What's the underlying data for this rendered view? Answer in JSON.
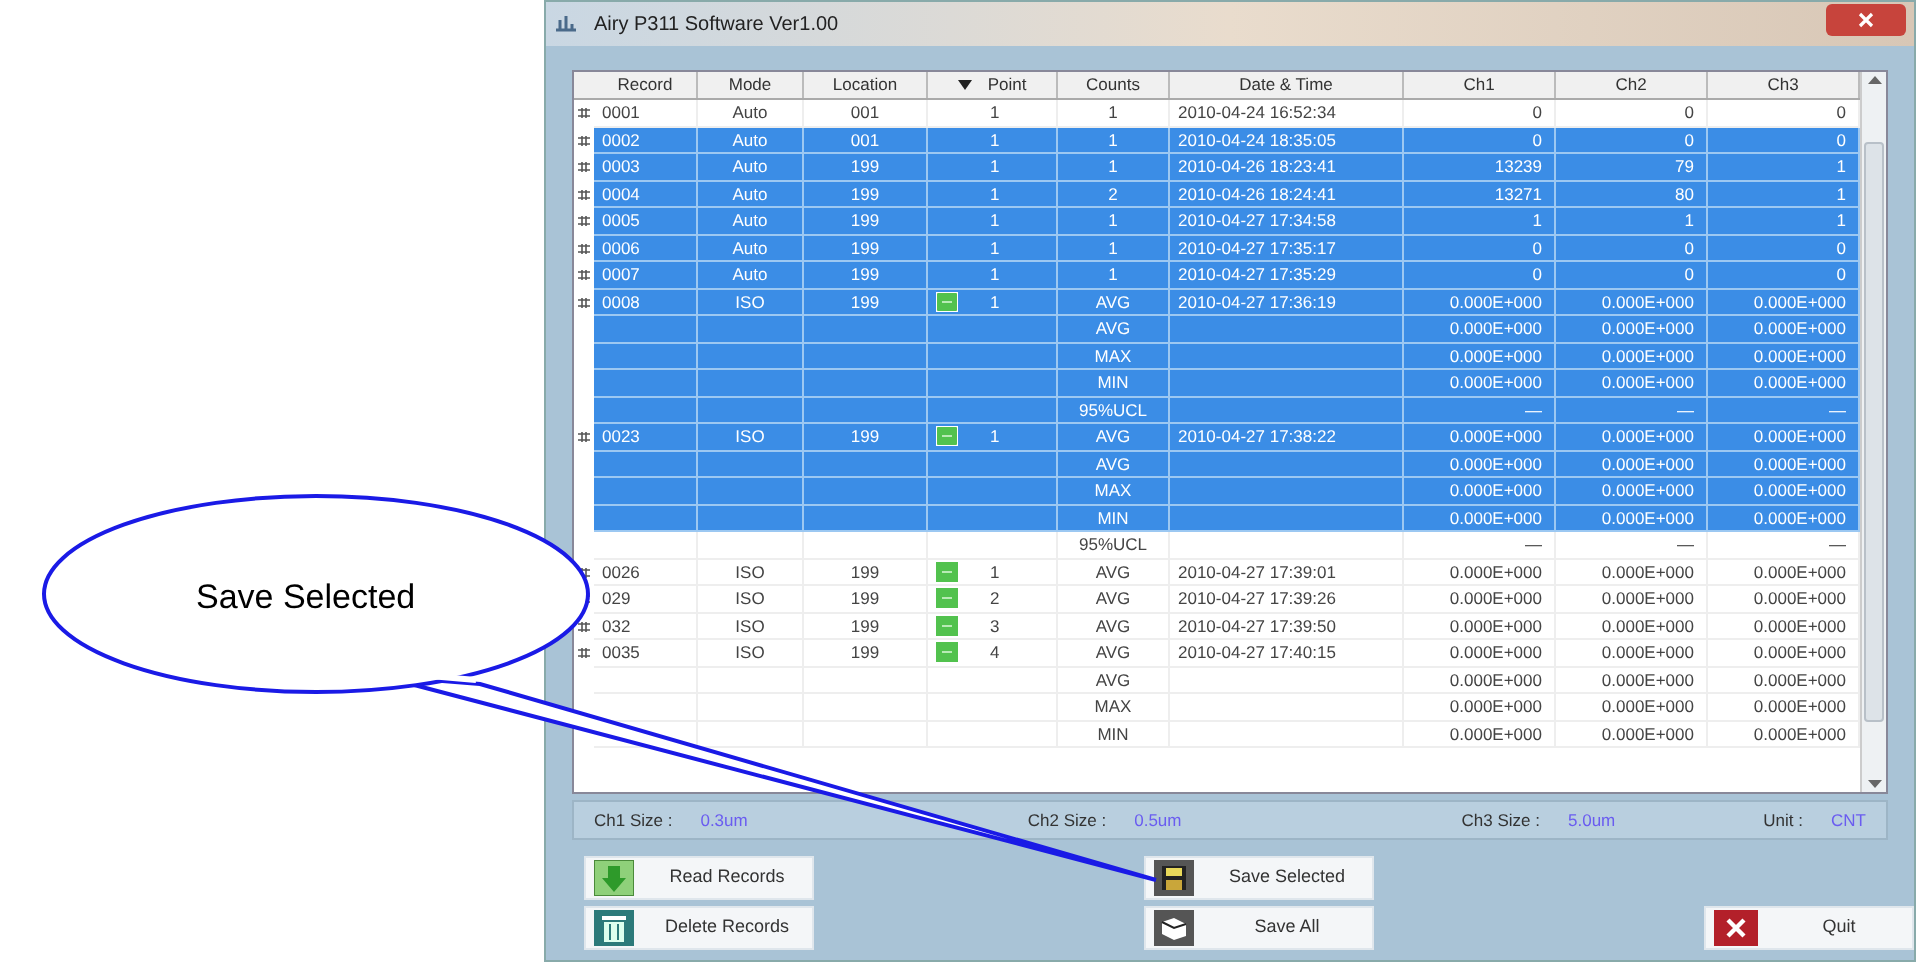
{
  "window": {
    "title": "Airy P311 Software Ver1.00"
  },
  "table": {
    "columns": [
      "Record",
      "Mode",
      "Location",
      "Point",
      "Counts",
      "Date & Time",
      "Ch1",
      "Ch2",
      "Ch3"
    ],
    "rows": [
      {
        "selected": false,
        "record": "0001",
        "mode": "Auto",
        "location": "001",
        "point": "1",
        "counts": "1",
        "date_time": "2010-04-24 16:52:34",
        "ch1": "0",
        "ch2": "0",
        "ch3": "0"
      },
      {
        "selected": true,
        "record": "0002",
        "mode": "Auto",
        "location": "001",
        "point": "1",
        "counts": "1",
        "date_time": "2010-04-24 18:35:05",
        "ch1": "0",
        "ch2": "0",
        "ch3": "0"
      },
      {
        "selected": true,
        "record": "0003",
        "mode": "Auto",
        "location": "199",
        "point": "1",
        "counts": "1",
        "date_time": "2010-04-26 18:23:41",
        "ch1": "13239",
        "ch2": "79",
        "ch3": "1"
      },
      {
        "selected": true,
        "record": "0004",
        "mode": "Auto",
        "location": "199",
        "point": "1",
        "counts": "2",
        "date_time": "2010-04-26 18:24:41",
        "ch1": "13271",
        "ch2": "80",
        "ch3": "1"
      },
      {
        "selected": true,
        "record": "0005",
        "mode": "Auto",
        "location": "199",
        "point": "1",
        "counts": "1",
        "date_time": "2010-04-27 17:34:58",
        "ch1": "1",
        "ch2": "1",
        "ch3": "1"
      },
      {
        "selected": true,
        "record": "0006",
        "mode": "Auto",
        "location": "199",
        "point": "1",
        "counts": "1",
        "date_time": "2010-04-27 17:35:17",
        "ch1": "0",
        "ch2": "0",
        "ch3": "0"
      },
      {
        "selected": true,
        "record": "0007",
        "mode": "Auto",
        "location": "199",
        "point": "1",
        "counts": "1",
        "date_time": "2010-04-27 17:35:29",
        "ch1": "0",
        "ch2": "0",
        "ch3": "0"
      },
      {
        "selected": true,
        "record": "0008",
        "mode": "ISO",
        "location": "199",
        "flagged": true,
        "point": "1",
        "counts": "AVG",
        "date_time": "2010-04-27 17:36:19",
        "ch1": "0.000E+000",
        "ch2": "0.000E+000",
        "ch3": "0.000E+000"
      },
      {
        "selected": true,
        "counts": "AVG",
        "ch1": "0.000E+000",
        "ch2": "0.000E+000",
        "ch3": "0.000E+000"
      },
      {
        "selected": true,
        "counts": "MAX",
        "ch1": "0.000E+000",
        "ch2": "0.000E+000",
        "ch3": "0.000E+000"
      },
      {
        "selected": true,
        "counts": "MIN",
        "ch1": "0.000E+000",
        "ch2": "0.000E+000",
        "ch3": "0.000E+000"
      },
      {
        "selected": true,
        "counts": "95%UCL",
        "ch1": "—",
        "ch2": "—",
        "ch3": "—"
      },
      {
        "selected": true,
        "record": "0023",
        "mode": "ISO",
        "location": "199",
        "flagged": true,
        "point": "1",
        "counts": "AVG",
        "date_time": "2010-04-27 17:38:22",
        "ch1": "0.000E+000",
        "ch2": "0.000E+000",
        "ch3": "0.000E+000"
      },
      {
        "selected": true,
        "counts": "AVG",
        "ch1": "0.000E+000",
        "ch2": "0.000E+000",
        "ch3": "0.000E+000"
      },
      {
        "selected": true,
        "counts": "MAX",
        "ch1": "0.000E+000",
        "ch2": "0.000E+000",
        "ch3": "0.000E+000"
      },
      {
        "selected": true,
        "counts": "MIN",
        "ch1": "0.000E+000",
        "ch2": "0.000E+000",
        "ch3": "0.000E+000"
      },
      {
        "selected": false,
        "counts": "95%UCL",
        "ch1": "—",
        "ch2": "—",
        "ch3": "—"
      },
      {
        "selected": false,
        "record": "0026",
        "mode": "ISO",
        "location": "199",
        "flagged": true,
        "point": "1",
        "counts": "AVG",
        "date_time": "2010-04-27 17:39:01",
        "ch1": "0.000E+000",
        "ch2": "0.000E+000",
        "ch3": "0.000E+000"
      },
      {
        "selected": false,
        "record": "029",
        "mode": "ISO",
        "location": "199",
        "flagged": true,
        "point": "2",
        "counts": "AVG",
        "date_time": "2010-04-27 17:39:26",
        "ch1": "0.000E+000",
        "ch2": "0.000E+000",
        "ch3": "0.000E+000"
      },
      {
        "selected": false,
        "record": "032",
        "mode": "ISO",
        "location": "199",
        "flagged": true,
        "point": "3",
        "counts": "AVG",
        "date_time": "2010-04-27 17:39:50",
        "ch1": "0.000E+000",
        "ch2": "0.000E+000",
        "ch3": "0.000E+000"
      },
      {
        "selected": false,
        "record": "0035",
        "mode": "ISO",
        "location": "199",
        "flagged": true,
        "point": "4",
        "counts": "AVG",
        "date_time": "2010-04-27 17:40:15",
        "ch1": "0.000E+000",
        "ch2": "0.000E+000",
        "ch3": "0.000E+000"
      },
      {
        "selected": false,
        "counts": "AVG",
        "ch1": "0.000E+000",
        "ch2": "0.000E+000",
        "ch3": "0.000E+000"
      },
      {
        "selected": false,
        "counts": "MAX",
        "ch1": "0.000E+000",
        "ch2": "0.000E+000",
        "ch3": "0.000E+000"
      },
      {
        "selected": false,
        "counts": "MIN",
        "ch1": "0.000E+000",
        "ch2": "0.000E+000",
        "ch3": "0.000E+000"
      }
    ]
  },
  "sizes": [
    {
      "label": "Ch1 Size :",
      "value": "0.3um"
    },
    {
      "label": "Ch2 Size :",
      "value": "0.5um"
    },
    {
      "label": "Ch3 Size :",
      "value": "5.0um"
    },
    {
      "label": "Unit :",
      "value": "CNT"
    }
  ],
  "buttons": [
    {
      "kind": "read",
      "label": "Read Records"
    },
    {
      "kind": "save",
      "label": "Save Selected"
    },
    {
      "kind": "delete",
      "label": "Delete Records"
    },
    {
      "kind": "saveall",
      "label": "Save All"
    },
    {
      "kind": "quit",
      "label": "Quit"
    }
  ],
  "callout": {
    "text": "Save Selected"
  }
}
